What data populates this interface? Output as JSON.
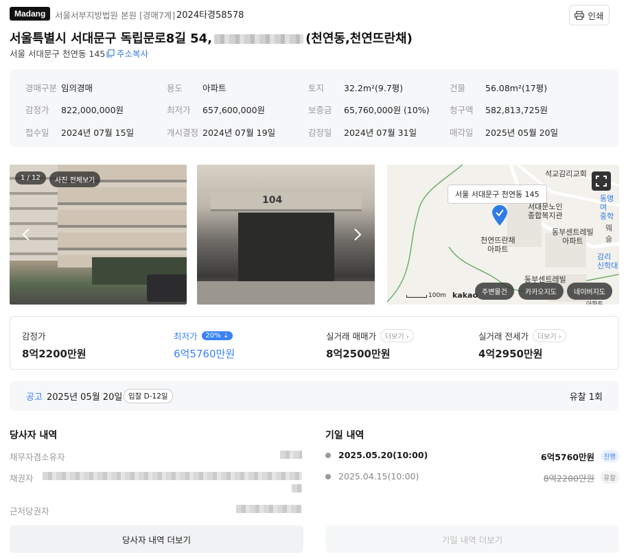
{
  "header": {
    "logo": "Madang",
    "court": "서울서부지방법원 본원 [경매7계]",
    "case_no": "2024타경58578",
    "print_label": "인쇄"
  },
  "title": {
    "part1": "서울특별시 서대문구 독립문로8길 54,",
    "part2": "(천연동,천연뜨란채)"
  },
  "address": {
    "short": "서울 서대문구 천연동 145",
    "copy_label": "주소복사"
  },
  "info": [
    {
      "k": "경매구분",
      "v": "임의경매"
    },
    {
      "k": "용도",
      "v": "아파트"
    },
    {
      "k": "토지",
      "v": "32.2m²(9.7평)"
    },
    {
      "k": "건물",
      "v": "56.08m²(17평)"
    },
    {
      "k": "감정가",
      "v": "822,000,000원"
    },
    {
      "k": "최저가",
      "v": "657,600,000원"
    },
    {
      "k": "보증금",
      "v": "65,760,000원 (10%)"
    },
    {
      "k": "청구액",
      "v": "582,813,725원"
    },
    {
      "k": "접수일",
      "v": "2024년 07월 15일"
    },
    {
      "k": "개시결정",
      "v": "2024년 07월 19일"
    },
    {
      "k": "감정일",
      "v": "2024년 07월 31일"
    },
    {
      "k": "매각일",
      "v": "2025년 05월 20일"
    }
  ],
  "photos": {
    "counter": "1 / 12",
    "view_all": "사진 전체보기"
  },
  "map": {
    "tooltip": "서울 서대문구 천연동 145",
    "labels": [
      "석교감리교회",
      "서대문노인",
      "종합복지관",
      "천연뜨란채",
      "아파트",
      "동부센트레빌",
      "아파트",
      "동부센트레빌",
      "동명여",
      "중학",
      "웨슬",
      "감리",
      "신학대",
      "아파트"
    ],
    "scale": "100m",
    "brand": "kakao",
    "btn1": "주변물건",
    "btn2": "카카오지도",
    "btn3": "네이버지도"
  },
  "prices": [
    {
      "label": "감정가",
      "value": "8억2200만원"
    },
    {
      "label": "최저가",
      "value": "6억5760만원",
      "pct": "20%"
    },
    {
      "label": "실거래 매매가",
      "value": "8억2500만원",
      "more": "더보기"
    },
    {
      "label": "실거래 전세가",
      "value": "4억2950만원",
      "more": "더보기"
    }
  ],
  "notice": {
    "label": "공고",
    "date": "2025년 05월 20일",
    "dday": "입찰 D-12일",
    "result": "유찰 1회"
  },
  "parties": {
    "title": "당사자 내역",
    "rows": [
      "채무자겸소유자",
      "채권자",
      "근저당권자"
    ],
    "more": "당사자 내역 더보기"
  },
  "schedule": {
    "title": "기일 내역",
    "items": [
      {
        "date": "2025.05.20(10:00)",
        "price": "6억5760만원",
        "status": "진행"
      },
      {
        "date": "2025.04.15(10:00)",
        "price": "8억2200만원",
        "status": "유찰"
      }
    ],
    "more": "기일 내역 더보기"
  },
  "colors": {
    "accent": "#3b82f6",
    "map_pin": "#2f7be6"
  }
}
